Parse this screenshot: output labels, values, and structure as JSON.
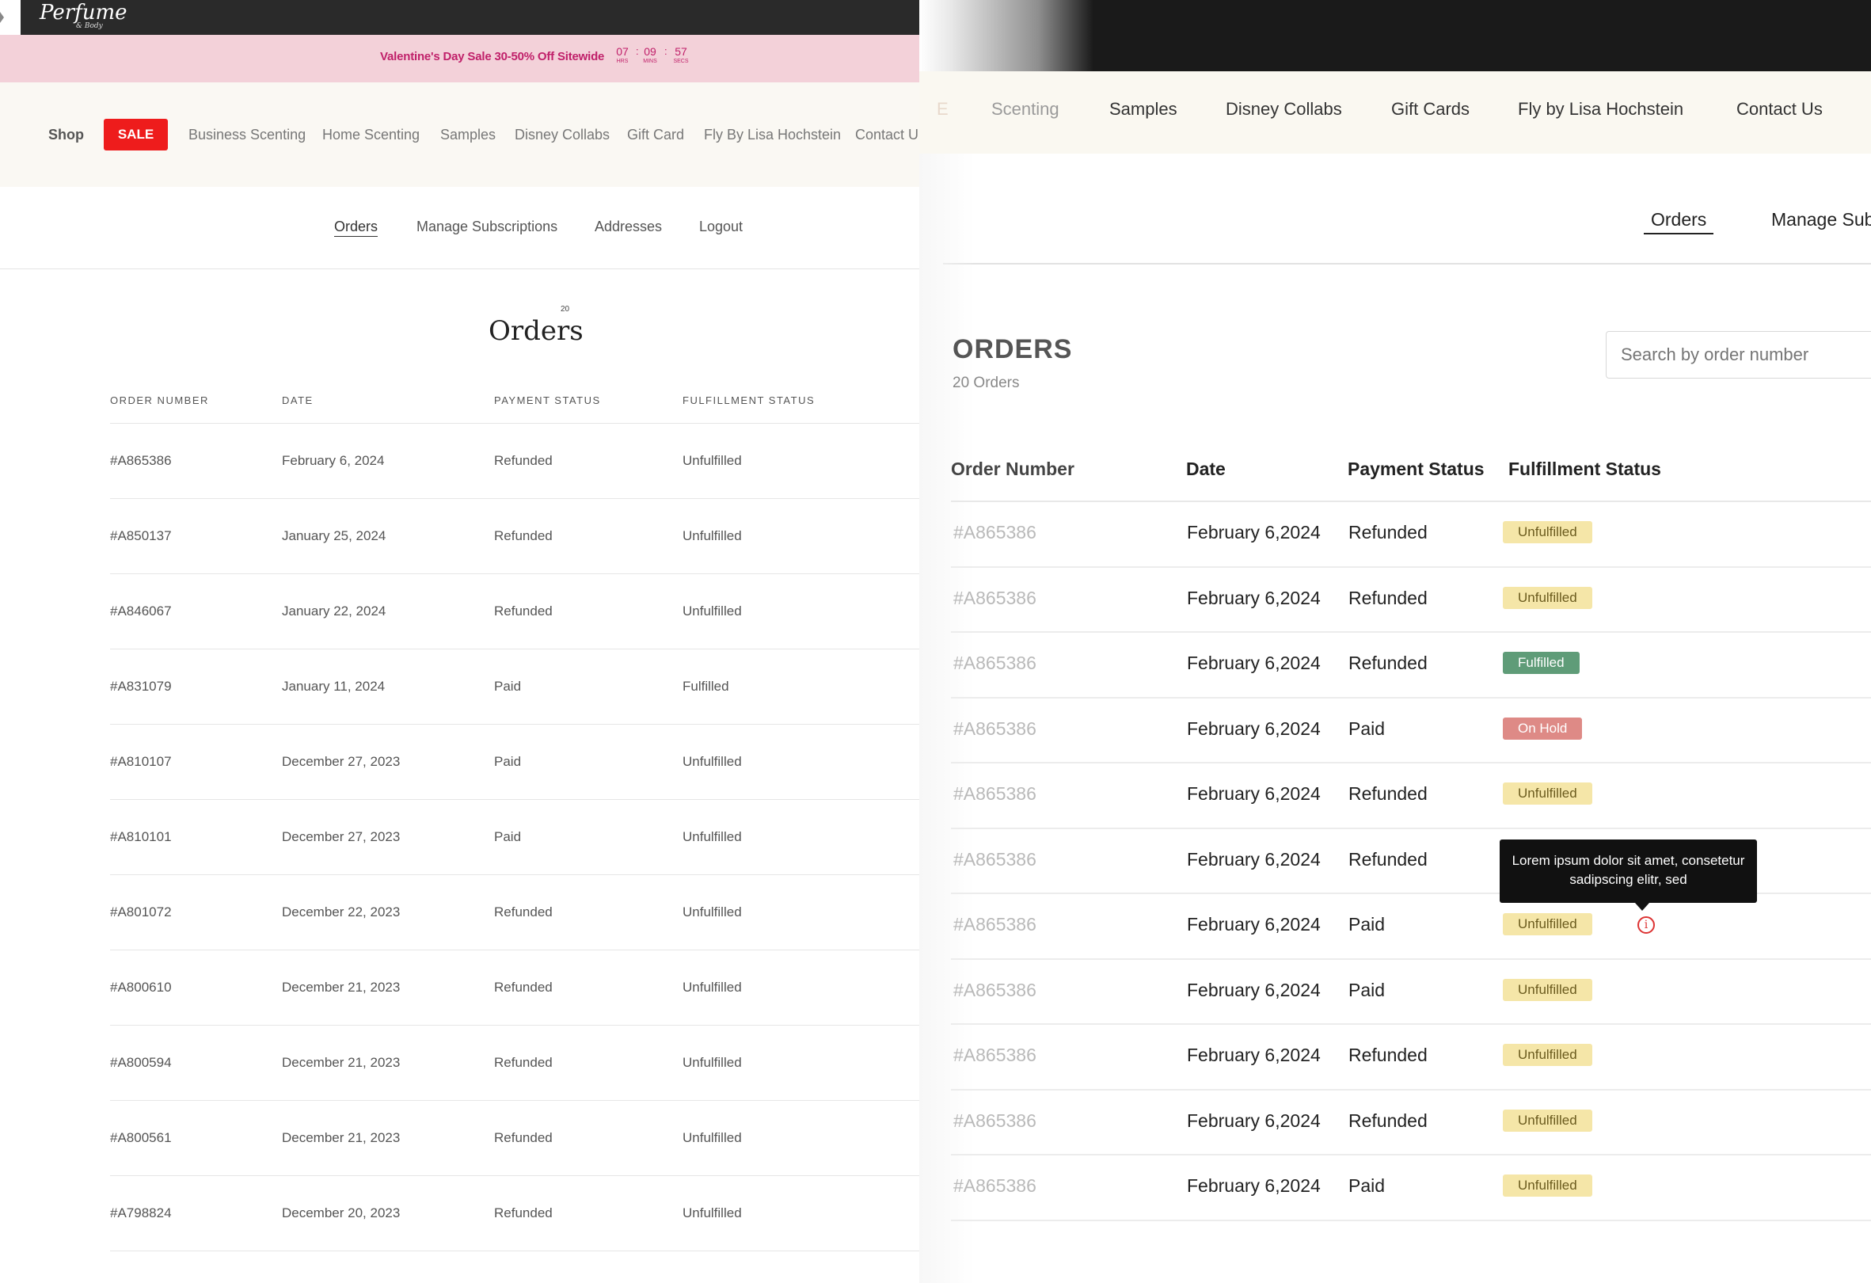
{
  "left": {
    "brand": {
      "logo": "Perfume",
      "logo_sub": "& Body"
    },
    "promo": {
      "text": "Valentine's Day Sale 30-50% Off Sitewide",
      "countdown": [
        {
          "value": "07",
          "unit": "HRS"
        },
        {
          "value": "09",
          "unit": "MINS"
        },
        {
          "value": "57",
          "unit": "SECS"
        }
      ]
    },
    "nav": {
      "shop": "Shop",
      "sale": "SALE",
      "items": [
        "Business Scenting",
        "Home Scenting",
        "Samples",
        "Disney Collabs",
        "Gift Card",
        "Fly By Lisa Hochstein",
        "Contact U"
      ]
    },
    "account_tabs": [
      "Orders",
      "Manage Subscriptions",
      "Addresses",
      "Logout"
    ],
    "orders_count": "20",
    "title": "Orders",
    "table": {
      "headers": [
        "ORDER NUMBER",
        "DATE",
        "PAYMENT STATUS",
        "FULFILLMENT STATUS"
      ],
      "rows": [
        [
          "#A865386",
          "February 6, 2024",
          "Refunded",
          "Unfulfilled"
        ],
        [
          "#A850137",
          "January 25, 2024",
          "Refunded",
          "Unfulfilled"
        ],
        [
          "#A846067",
          "January 22, 2024",
          "Refunded",
          "Unfulfilled"
        ],
        [
          "#A831079",
          "January 11, 2024",
          "Paid",
          "Fulfilled"
        ],
        [
          "#A810107",
          "December 27, 2023",
          "Paid",
          "Unfulfilled"
        ],
        [
          "#A810101",
          "December 27, 2023",
          "Paid",
          "Unfulfilled"
        ],
        [
          "#A801072",
          "December 22, 2023",
          "Refunded",
          "Unfulfilled"
        ],
        [
          "#A800610",
          "December 21, 2023",
          "Refunded",
          "Unfulfilled"
        ],
        [
          "#A800594",
          "December 21, 2023",
          "Refunded",
          "Unfulfilled"
        ],
        [
          "#A800561",
          "December 21, 2023",
          "Refunded",
          "Unfulfilled"
        ],
        [
          "#A798824",
          "December 20, 2023",
          "Refunded",
          "Unfulfilled"
        ]
      ]
    }
  },
  "right": {
    "nav": {
      "cut": "E",
      "items": [
        "Scenting",
        "Samples",
        "Disney Collabs",
        "Gift Cards",
        "Fly by Lisa Hochstein",
        "Contact Us"
      ]
    },
    "account_tabs": [
      "Orders",
      "Manage Subsc"
    ],
    "title": "ORDERS",
    "count": "20 Orders",
    "search_placeholder": "Search by order number",
    "table": {
      "headers": [
        "Order Number",
        "Date",
        "Payment Status",
        "Fulfillment Status"
      ],
      "rows": [
        {
          "order": "#A865386",
          "date": "February 6,2024",
          "payment": "Refunded",
          "status": "Unfulfilled"
        },
        {
          "order": "#A865386",
          "date": "February 6,2024",
          "payment": "Refunded",
          "status": "Unfulfilled"
        },
        {
          "order": "#A865386",
          "date": "February 6,2024",
          "payment": "Refunded",
          "status": "Fulfilled"
        },
        {
          "order": "#A865386",
          "date": "February 6,2024",
          "payment": "Paid",
          "status": "On Hold"
        },
        {
          "order": "#A865386",
          "date": "February 6,2024",
          "payment": "Refunded",
          "status": "Unfulfilled"
        },
        {
          "order": "#A865386",
          "date": "February 6,2024",
          "payment": "Refunded",
          "status": ""
        },
        {
          "order": "#A865386",
          "date": "February 6,2024",
          "payment": "Paid",
          "status": "Unfulfilled"
        },
        {
          "order": "#A865386",
          "date": "February 6,2024",
          "payment": "Paid",
          "status": "Unfulfilled"
        },
        {
          "order": "#A865386",
          "date": "February 6,2024",
          "payment": "Refunded",
          "status": "Unfulfilled"
        },
        {
          "order": "#A865386",
          "date": "February 6,2024",
          "payment": "Refunded",
          "status": "Unfulfilled"
        },
        {
          "order": "#A865386",
          "date": "February 6,2024",
          "payment": "Paid",
          "status": "Unfulfilled"
        }
      ]
    },
    "tooltip": "Lorem ipsum dolor sit amet, consetetur sadipscing elitr, sed",
    "info_icon": "info-icon",
    "badge_colors": {
      "Unfulfilled": {
        "bg": "#f5e6a8",
        "fg": "#6b5b1e"
      },
      "Fulfilled": {
        "bg": "#5f9c78",
        "fg": "#ffffff"
      },
      "On Hold": {
        "bg": "#de8a86",
        "fg": "#ffffff"
      }
    }
  }
}
